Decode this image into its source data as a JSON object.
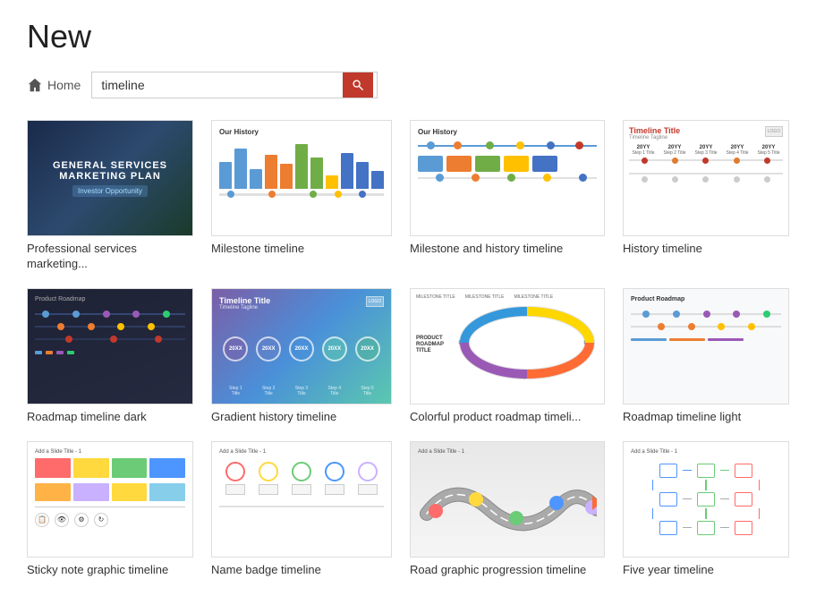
{
  "page": {
    "title": "New"
  },
  "search": {
    "home_label": "Home",
    "placeholder": "timeline",
    "value": "timeline",
    "search_icon": "🔍"
  },
  "templates": [
    {
      "id": "professional-services",
      "label": "Professional services marketing...",
      "type": "dark-marketing"
    },
    {
      "id": "milestone-timeline",
      "label": "Milestone timeline",
      "type": "milestone"
    },
    {
      "id": "milestone-history",
      "label": "Milestone and history timeline",
      "type": "milestone-history"
    },
    {
      "id": "history-timeline",
      "label": "History timeline",
      "type": "history-timeline"
    },
    {
      "id": "roadmap-dark",
      "label": "Roadmap timeline dark",
      "type": "roadmap-dark"
    },
    {
      "id": "gradient-history",
      "label": "Gradient history timeline",
      "type": "gradient-history"
    },
    {
      "id": "colorful-roadmap",
      "label": "Colorful product roadmap timeli...",
      "type": "colorful-roadmap"
    },
    {
      "id": "roadmap-light",
      "label": "Roadmap timeline light",
      "type": "roadmap-light"
    },
    {
      "id": "sticky-note",
      "label": "Sticky note graphic timeline",
      "type": "sticky-note"
    },
    {
      "id": "name-badge",
      "label": "Name badge timeline",
      "type": "name-badge"
    },
    {
      "id": "road-progression",
      "label": "Road graphic progression timeline",
      "type": "road-progression"
    },
    {
      "id": "five-year",
      "label": "Five year timeline",
      "type": "five-year"
    }
  ],
  "colors": {
    "accent": "#c0392b",
    "search_btn": "#d04030"
  }
}
